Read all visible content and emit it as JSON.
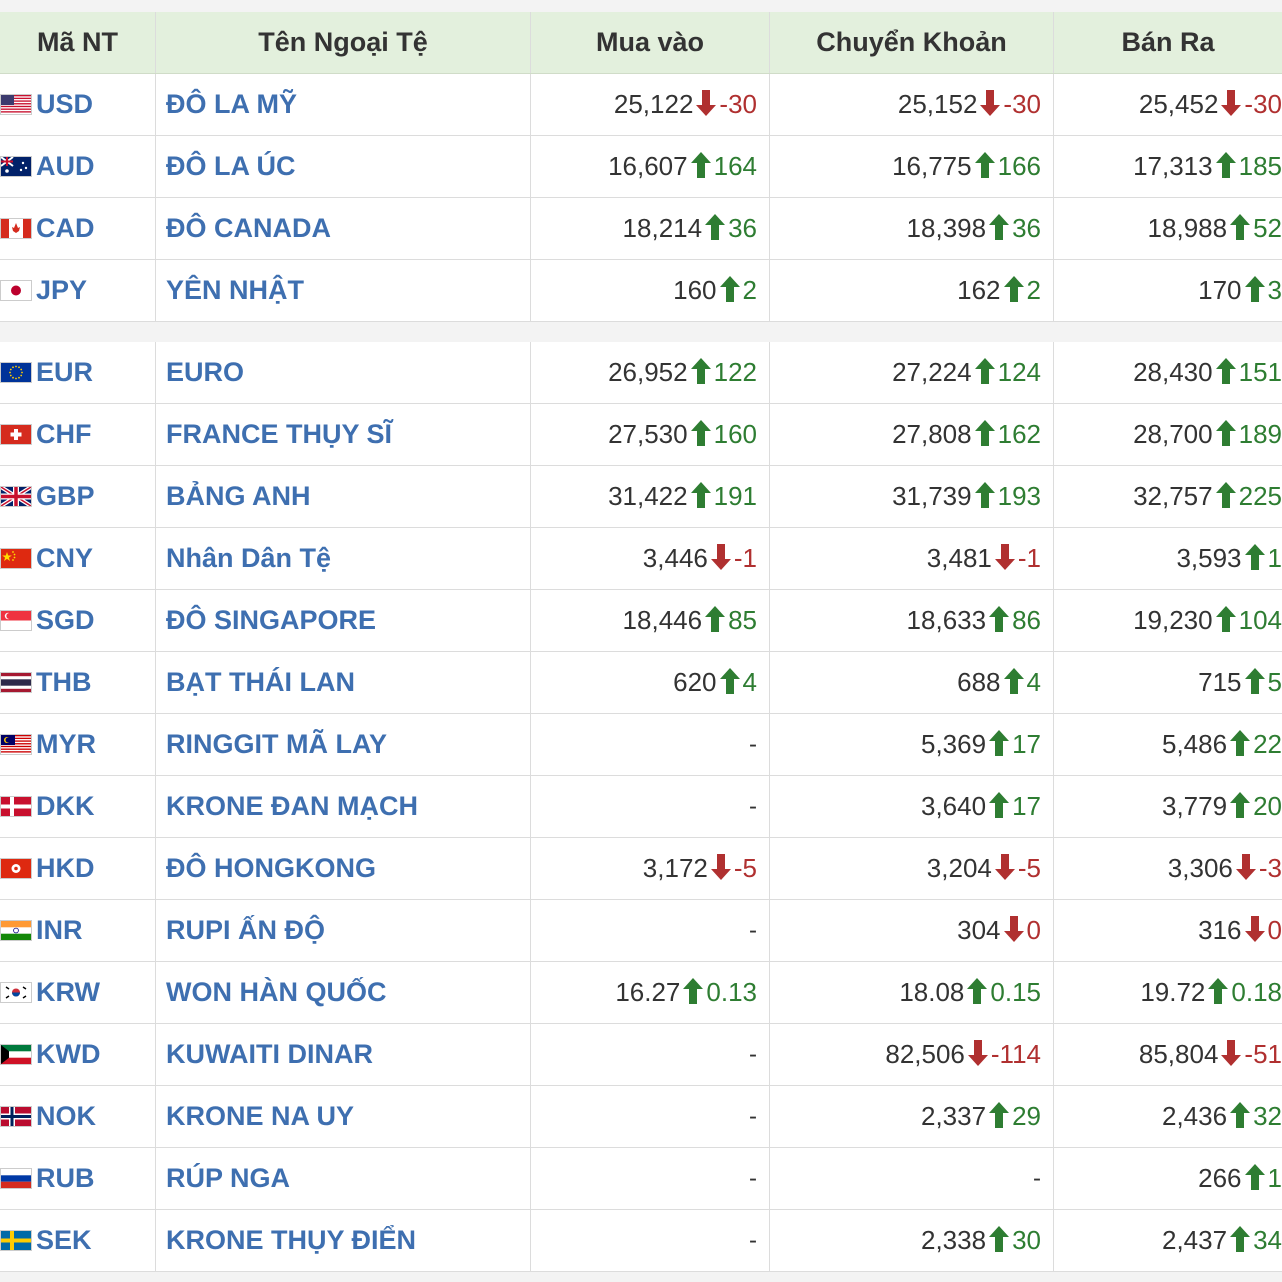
{
  "headers": [
    "Mã NT",
    "Tên Ngoại Tệ",
    "Mua vào",
    "Chuyển Khoản",
    "Bán Ra"
  ],
  "colors": {
    "up": "#2e7d32",
    "down": "#b03030",
    "link": "#3e6fb0",
    "header_bg": "#e3f0dd"
  },
  "rows": [
    {
      "code": "USD",
      "name": "ĐÔ LA MỸ",
      "flag": "flag-us-icon",
      "buy": {
        "v": "25,122",
        "d": "down",
        "c": "-30"
      },
      "transfer": {
        "v": "25,152",
        "d": "down",
        "c": "-30"
      },
      "sell": {
        "v": "25,452",
        "d": "down",
        "c": "-30"
      }
    },
    {
      "code": "AUD",
      "name": "ĐÔ LA ÚC",
      "flag": "flag-au-icon",
      "buy": {
        "v": "16,607",
        "d": "up",
        "c": "164"
      },
      "transfer": {
        "v": "16,775",
        "d": "up",
        "c": "166"
      },
      "sell": {
        "v": "17,313",
        "d": "up",
        "c": "185"
      }
    },
    {
      "code": "CAD",
      "name": "ĐÔ CANADA",
      "flag": "flag-ca-icon",
      "buy": {
        "v": "18,214",
        "d": "up",
        "c": "36"
      },
      "transfer": {
        "v": "18,398",
        "d": "up",
        "c": "36"
      },
      "sell": {
        "v": "18,988",
        "d": "up",
        "c": "52"
      }
    },
    {
      "code": "JPY",
      "name": "YÊN NHẬT",
      "flag": "flag-jp-icon",
      "buy": {
        "v": "160",
        "d": "up",
        "c": "2"
      },
      "transfer": {
        "v": "162",
        "d": "up",
        "c": "2"
      },
      "sell": {
        "v": "170",
        "d": "up",
        "c": "3"
      }
    },
    {
      "code": "EUR",
      "name": "EURO",
      "flag": "flag-eu-icon",
      "buy": {
        "v": "26,952",
        "d": "up",
        "c": "122"
      },
      "transfer": {
        "v": "27,224",
        "d": "up",
        "c": "124"
      },
      "sell": {
        "v": "28,430",
        "d": "up",
        "c": "151"
      }
    },
    {
      "code": "CHF",
      "name": "FRANCE THỤY SĨ",
      "flag": "flag-ch-icon",
      "buy": {
        "v": "27,530",
        "d": "up",
        "c": "160"
      },
      "transfer": {
        "v": "27,808",
        "d": "up",
        "c": "162"
      },
      "sell": {
        "v": "28,700",
        "d": "up",
        "c": "189"
      }
    },
    {
      "code": "GBP",
      "name": "BẢNG ANH",
      "flag": "flag-gb-icon",
      "buy": {
        "v": "31,422",
        "d": "up",
        "c": "191"
      },
      "transfer": {
        "v": "31,739",
        "d": "up",
        "c": "193"
      },
      "sell": {
        "v": "32,757",
        "d": "up",
        "c": "225"
      }
    },
    {
      "code": "CNY",
      "name": "Nhân Dân Tệ",
      "flag": "flag-cn-icon",
      "buy": {
        "v": "3,446",
        "d": "down",
        "c": "-1"
      },
      "transfer": {
        "v": "3,481",
        "d": "down",
        "c": "-1"
      },
      "sell": {
        "v": "3,593",
        "d": "up",
        "c": "1"
      }
    },
    {
      "code": "SGD",
      "name": "ĐÔ SINGAPORE",
      "flag": "flag-sg-icon",
      "buy": {
        "v": "18,446",
        "d": "up",
        "c": "85"
      },
      "transfer": {
        "v": "18,633",
        "d": "up",
        "c": "86"
      },
      "sell": {
        "v": "19,230",
        "d": "up",
        "c": "104"
      }
    },
    {
      "code": "THB",
      "name": "BẠT THÁI LAN",
      "flag": "flag-th-icon",
      "buy": {
        "v": "620",
        "d": "up",
        "c": "4"
      },
      "transfer": {
        "v": "688",
        "d": "up",
        "c": "4"
      },
      "sell": {
        "v": "715",
        "d": "up",
        "c": "5"
      }
    },
    {
      "code": "MYR",
      "name": "RINGGIT MÃ LAY",
      "flag": "flag-my-icon",
      "buy": null,
      "transfer": {
        "v": "5,369",
        "d": "up",
        "c": "17"
      },
      "sell": {
        "v": "5,486",
        "d": "up",
        "c": "22"
      }
    },
    {
      "code": "DKK",
      "name": "KRONE ĐAN MẠCH",
      "flag": "flag-dk-icon",
      "buy": null,
      "transfer": {
        "v": "3,640",
        "d": "up",
        "c": "17"
      },
      "sell": {
        "v": "3,779",
        "d": "up",
        "c": "20"
      }
    },
    {
      "code": "HKD",
      "name": "ĐÔ HONGKONG",
      "flag": "flag-hk-icon",
      "buy": {
        "v": "3,172",
        "d": "down",
        "c": "-5"
      },
      "transfer": {
        "v": "3,204",
        "d": "down",
        "c": "-5"
      },
      "sell": {
        "v": "3,306",
        "d": "down",
        "c": "-3"
      }
    },
    {
      "code": "INR",
      "name": "RUPI ẤN ĐỘ",
      "flag": "flag-in-icon",
      "buy": null,
      "transfer": {
        "v": "304",
        "d": "down",
        "c": "0"
      },
      "sell": {
        "v": "316",
        "d": "down",
        "c": "0"
      }
    },
    {
      "code": "KRW",
      "name": "WON HÀN QUỐC",
      "flag": "flag-kr-icon",
      "buy": {
        "v": "16.27",
        "d": "up",
        "c": "0.13"
      },
      "transfer": {
        "v": "18.08",
        "d": "up",
        "c": "0.15"
      },
      "sell": {
        "v": "19.72",
        "d": "up",
        "c": "0.18"
      }
    },
    {
      "code": "KWD",
      "name": "KUWAITI DINAR",
      "flag": "flag-kw-icon",
      "buy": null,
      "transfer": {
        "v": "82,506",
        "d": "down",
        "c": "-114"
      },
      "sell": {
        "v": "85,804",
        "d": "down",
        "c": "-51"
      }
    },
    {
      "code": "NOK",
      "name": "KRONE NA UY",
      "flag": "flag-no-icon",
      "buy": null,
      "transfer": {
        "v": "2,337",
        "d": "up",
        "c": "29"
      },
      "sell": {
        "v": "2,436",
        "d": "up",
        "c": "32"
      }
    },
    {
      "code": "RUB",
      "name": "RÚP NGA",
      "flag": "flag-ru-icon",
      "buy": null,
      "transfer": null,
      "sell": {
        "v": "266",
        "d": "up",
        "c": "1"
      }
    },
    {
      "code": "SEK",
      "name": "KRONE THỤY ĐIỂN",
      "flag": "flag-se-icon",
      "buy": null,
      "transfer": {
        "v": "2,338",
        "d": "up",
        "c": "30"
      },
      "sell": {
        "v": "2,437",
        "d": "up",
        "c": "34"
      }
    }
  ],
  "empty_value": "-"
}
